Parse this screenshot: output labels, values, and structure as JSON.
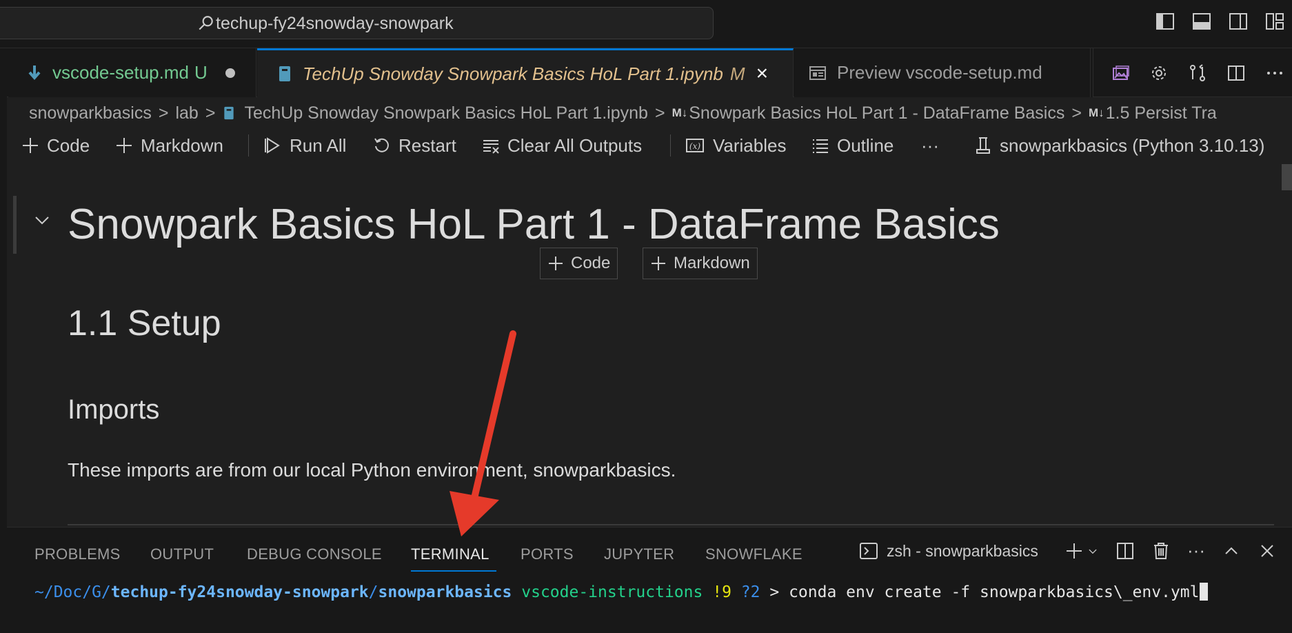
{
  "titlebar": {
    "search_text": "techup-fy24snowday-snowpark"
  },
  "tabs": [
    {
      "label": "vscode-setup.md",
      "status": "U"
    },
    {
      "label": "TechUp Snowday Snowpark Basics HoL Part 1.ipynb",
      "status": "M"
    },
    {
      "label": "Preview vscode-setup.md"
    }
  ],
  "breadcrumb": {
    "items": [
      "snowparkbasics",
      "lab",
      "TechUp Snowday Snowpark Basics HoL Part 1.ipynb",
      "Snowpark Basics HoL Part 1 - DataFrame Basics",
      "1.5 Persist Tra"
    ],
    "md_badge": "M↓"
  },
  "toolbar": {
    "code": "Code",
    "markdown": "Markdown",
    "run_all": "Run All",
    "restart": "Restart",
    "clear_outputs": "Clear All Outputs",
    "variables": "Variables",
    "outline": "Outline",
    "more": "···",
    "kernel": "snowparkbasics (Python 3.10.13)"
  },
  "notebook": {
    "h1": "Snowpark Basics HoL Part 1 - DataFrame Basics",
    "insert_code": "Code",
    "insert_markdown": "Markdown",
    "h2": "1.1 Setup",
    "h3": "Imports",
    "paragraph": "These imports are from our local Python environment, snowparkbasics."
  },
  "panel": {
    "tabs": [
      "PROBLEMS",
      "OUTPUT",
      "DEBUG CONSOLE",
      "TERMINAL",
      "PORTS",
      "JUPYTER",
      "SNOWFLAKE"
    ],
    "active_tab": "TERMINAL",
    "terminal_name": "zsh - snowparkbasics",
    "more": "···"
  },
  "terminal": {
    "path_prefix": "~/Doc/G/",
    "path_repo": "techup-fy24snowday-snowpark",
    "path_sep": "/",
    "path_dir": "snowparkbasics",
    "branch": "vscode-instructions",
    "flags": "!9",
    "untracked": "?2",
    "prompt": ">",
    "command": "conda env create -f snowparkbasics\\_env.yml"
  },
  "colors": {
    "accent": "#0078d4",
    "annotation_arrow": "#e53a2a",
    "untracked_file": "#73c991",
    "modified_file": "#e2c08d"
  }
}
